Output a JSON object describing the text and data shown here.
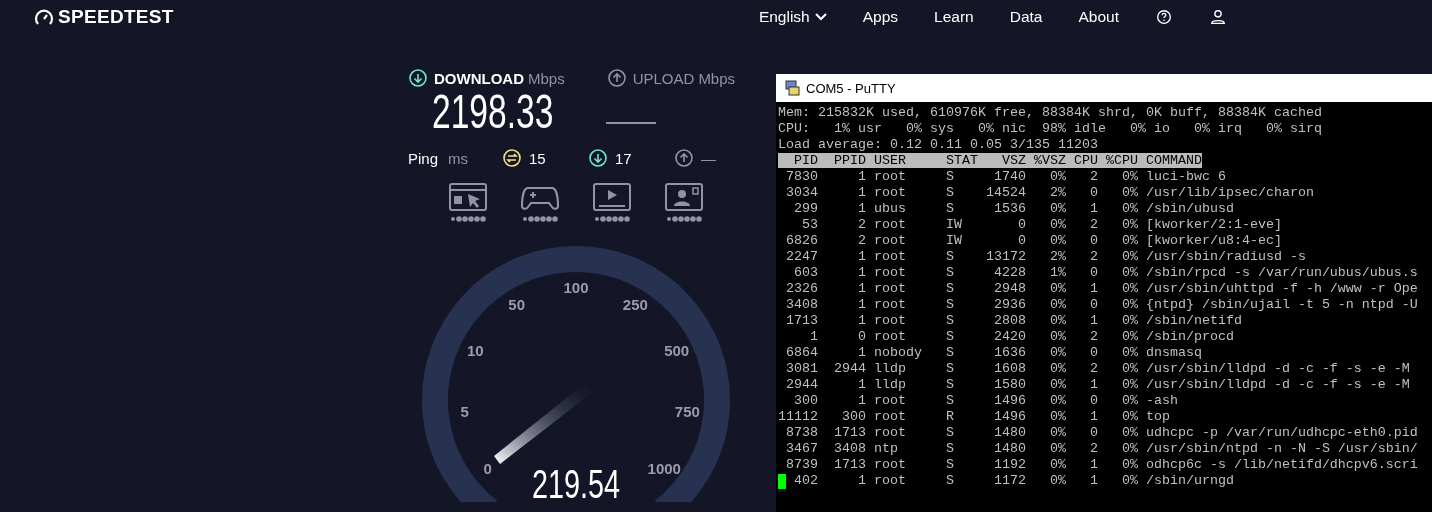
{
  "header": {
    "logo": "SPEEDTEST",
    "nav": [
      {
        "kind": "dropdown",
        "label": "English"
      },
      {
        "kind": "link",
        "label": "Apps"
      },
      {
        "kind": "link",
        "label": "Learn"
      },
      {
        "kind": "link",
        "label": "Data"
      },
      {
        "kind": "link",
        "label": "About"
      },
      {
        "kind": "help"
      },
      {
        "kind": "user"
      }
    ]
  },
  "speedtest": {
    "download": {
      "label": "DOWNLOAD",
      "unit": "Mbps",
      "value": "2198.33"
    },
    "upload": {
      "label": "UPLOAD",
      "unit": "Mbps"
    },
    "ping": {
      "label": "Ping",
      "unit": "ms",
      "values": [
        {
          "kind": "idle",
          "value": "15"
        },
        {
          "kind": "download",
          "value": "17"
        },
        {
          "kind": "upload",
          "value": "—"
        }
      ]
    },
    "experience": [
      {
        "kind": "browsing"
      },
      {
        "kind": "gaming"
      },
      {
        "kind": "video"
      },
      {
        "kind": "calls"
      }
    ],
    "gauge": {
      "labels": [
        "0",
        "5",
        "10",
        "50",
        "100",
        "250",
        "500",
        "750",
        "1000"
      ],
      "reading": "219.54"
    }
  },
  "terminal": {
    "title": "COM5 - PuTTY",
    "summary": [
      "Mem: 215832K used, 610976K free, 88384K shrd, 0K buff, 88384K cached",
      "CPU:   1% usr   0% sys   0% nic  98% idle   0% io   0% irq   0% sirq",
      "Load average: 0.12 0.11 0.05 3/135 11203"
    ],
    "header": "  PID  PPID USER     STAT   VSZ %VSZ CPU %CPU COMMAND",
    "rows": [
      {
        "text": " 7830     1 root     S     1740   0%   2   0% luci-bwc 6",
        "cursor": false
      },
      {
        "text": " 3034     1 root     S    14524   2%   0   0% /usr/lib/ipsec/charon",
        "cursor": false
      },
      {
        "text": "  299     1 ubus     S     1536   0%   1   0% /sbin/ubusd",
        "cursor": false
      },
      {
        "text": "   53     2 root     IW       0   0%   2   0% [kworker/2:1-eve]",
        "cursor": false
      },
      {
        "text": " 6826     2 root     IW       0   0%   0   0% [kworker/u8:4-ec]",
        "cursor": false
      },
      {
        "text": " 2247     1 root     S    13172   2%   2   0% /usr/sbin/radiusd -s",
        "cursor": false
      },
      {
        "text": "  603     1 root     S     4228   1%   0   0% /sbin/rpcd -s /var/run/ubus/ubus.s",
        "cursor": false
      },
      {
        "text": " 2326     1 root     S     2948   0%   1   0% /usr/sbin/uhttpd -f -h /www -r Ope",
        "cursor": false
      },
      {
        "text": " 3408     1 root     S     2936   0%   0   0% {ntpd} /sbin/ujail -t 5 -n ntpd -U",
        "cursor": false
      },
      {
        "text": " 1713     1 root     S     2808   0%   1   0% /sbin/netifd",
        "cursor": false
      },
      {
        "text": "    1     0 root     S     2420   0%   2   0% /sbin/procd",
        "cursor": false
      },
      {
        "text": " 6864     1 nobody   S     1636   0%   0   0% dnsmasq",
        "cursor": false
      },
      {
        "text": " 3081  2944 lldp     S     1608   0%   2   0% /usr/sbin/lldpd -d -c -f -s -e -M",
        "cursor": false
      },
      {
        "text": " 2944     1 lldp     S     1580   0%   1   0% /usr/sbin/lldpd -d -c -f -s -e -M",
        "cursor": false
      },
      {
        "text": "  300     1 root     S     1496   0%   0   0% -ash",
        "cursor": false
      },
      {
        "text": "11112   300 root     R     1496   0%   1   0% top",
        "cursor": false
      },
      {
        "text": " 8738  1713 root     S     1480   0%   0   0% udhcpc -p /var/run/udhcpc-eth0.pid",
        "cursor": false
      },
      {
        "text": " 3467  3408 ntp      S     1480   0%   2   0% /usr/sbin/ntpd -n -N -S /usr/sbin/",
        "cursor": false
      },
      {
        "text": " 8739  1713 root     S     1192   0%   1   0% odhcp6c -s /lib/netifd/dhcpv6.scri",
        "cursor": false
      },
      {
        "text": "  402     1 root     S     1172   0%   1   0% /sbin/urngd",
        "cursor": true
      }
    ]
  }
}
